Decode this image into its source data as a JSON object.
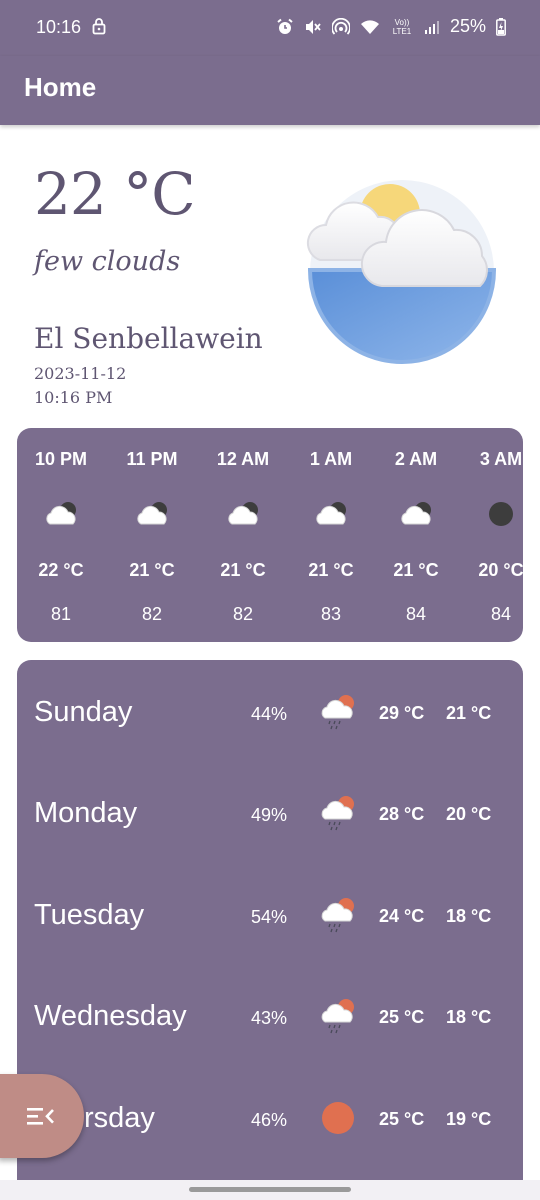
{
  "status_bar": {
    "time": "10:16",
    "network_label": "Vo)) LTE1",
    "battery": "25%"
  },
  "app_bar": {
    "title": "Home"
  },
  "current": {
    "temperature": "22 °C",
    "description": "few clouds",
    "city": "El Senbellawein",
    "date": "2023-11-12",
    "time": "10:16 PM",
    "icon": "sun-behind-clouds-icon"
  },
  "hourly": [
    {
      "time": "10 PM",
      "temp": "22 °C",
      "value": "81",
      "icon": "night-clouds-icon"
    },
    {
      "time": "11 PM",
      "temp": "21 °C",
      "value": "82",
      "icon": "night-clouds-icon"
    },
    {
      "time": "12 AM",
      "temp": "21 °C",
      "value": "82",
      "icon": "night-clouds-icon"
    },
    {
      "time": "1 AM",
      "temp": "21 °C",
      "value": "83",
      "icon": "night-clouds-icon"
    },
    {
      "time": "2 AM",
      "temp": "21 °C",
      "value": "84",
      "icon": "night-clouds-icon"
    },
    {
      "time": "3 AM",
      "temp": "20 °C",
      "value": "84",
      "icon": "clear-night-icon"
    }
  ],
  "daily": [
    {
      "day": "Sunday",
      "pct": "44%",
      "max": "29 °C",
      "min": "21 °C",
      "icon": "rain-sun-cloud-icon"
    },
    {
      "day": "Monday",
      "pct": "49%",
      "max": "28 °C",
      "min": "20 °C",
      "icon": "rain-sun-cloud-icon"
    },
    {
      "day": "Tuesday",
      "pct": "54%",
      "max": "24 °C",
      "min": "18 °C",
      "icon": "rain-sun-cloud-icon"
    },
    {
      "day": "Wednesday",
      "pct": "43%",
      "max": "25 °C",
      "min": "18 °C",
      "icon": "rain-sun-cloud-icon"
    },
    {
      "day": "Thursday",
      "pct": "46%",
      "max": "25 °C",
      "min": "19 °C",
      "icon": "sun-icon"
    }
  ],
  "colors": {
    "primary": "#7b6d8e",
    "text_dark": "#5f5672",
    "fab": "#bf8c86",
    "sun_orange": "#e07050"
  }
}
